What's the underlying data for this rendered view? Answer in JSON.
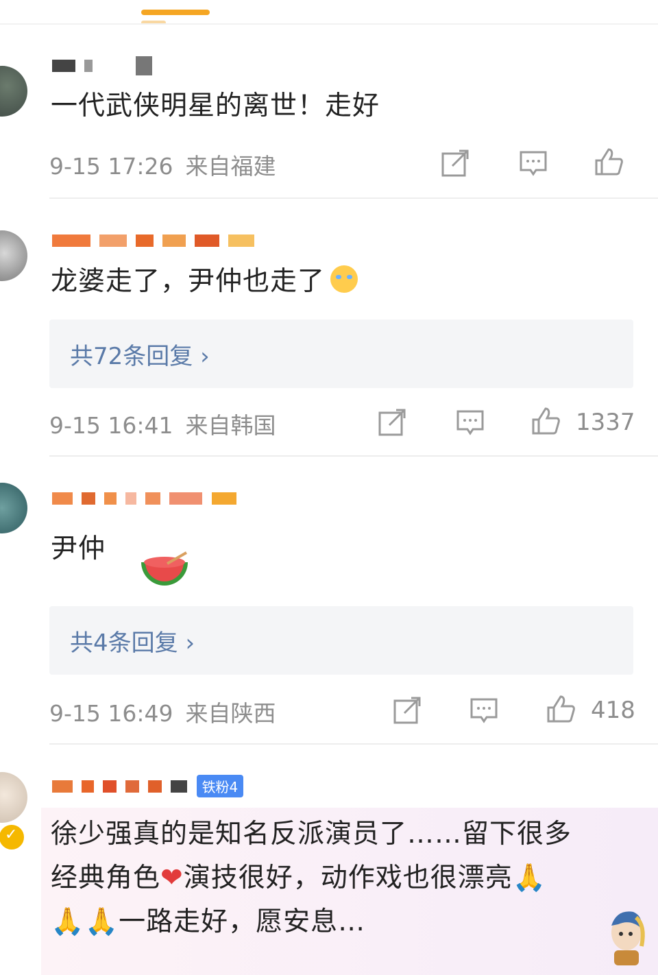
{
  "comments": [
    {
      "text": "一代武侠明星的离世！走好",
      "date": "9-15 17:26",
      "location": "来自福建",
      "likes": ""
    },
    {
      "text": "龙婆走了，尹仲也走了",
      "replies": "共72条回复 ›",
      "date": "9-15 16:41",
      "location": "来自韩国",
      "likes": "1337"
    },
    {
      "text": "尹仲",
      "replies": "共4条回复 ›",
      "date": "9-15 16:49",
      "location": "来自陕西",
      "likes": "418"
    },
    {
      "badge": "铁粉4",
      "text_line1": "徐少强真的是知名反派演员了……留下很多",
      "text_line2a": "经典角色",
      "text_line2b": "演技很好，动作戏也很漂亮",
      "text_line3": "一路走好，愿安息…"
    }
  ],
  "icons": {
    "share": "share-icon",
    "comment": "comment-icon",
    "like": "thumbs-up-icon",
    "heart": "❤",
    "pray": "🙏"
  },
  "colors": {
    "reply_link": "#5a7aa8",
    "meta": "#8d8d8d",
    "accent": "#f5a623"
  }
}
